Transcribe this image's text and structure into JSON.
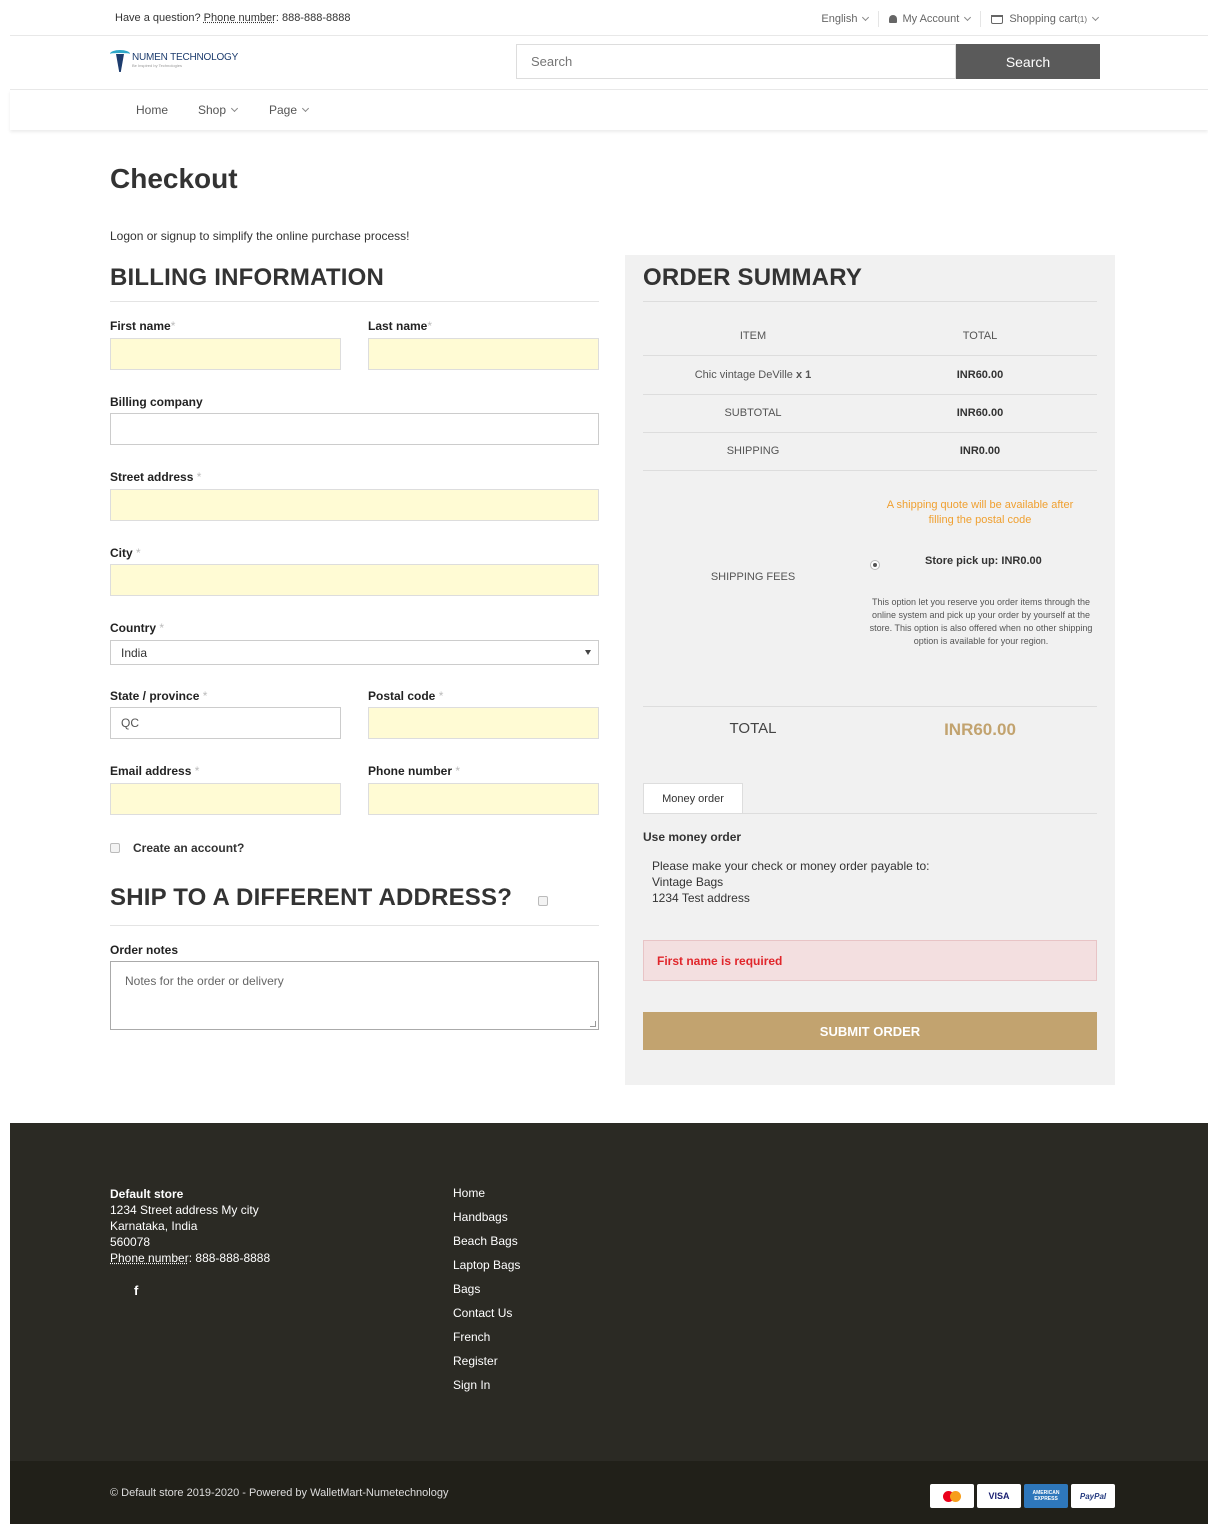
{
  "topbar": {
    "question_prefix": "Have a question? ",
    "phone_label": "Phone number",
    "phone_value": ": 888-888-8888",
    "language": "English",
    "account": "My Account",
    "cart": "Shopping cart",
    "cart_count": "(1)"
  },
  "header": {
    "logo_title": "NUMEN TECHNOLOGY",
    "logo_tagline": "Be Inspired by Technologies",
    "search_placeholder": "Search",
    "search_button": "Search"
  },
  "nav": {
    "home": "Home",
    "shop": "Shop",
    "page": "Page"
  },
  "page": {
    "title": "Checkout",
    "logon_message": "Logon or signup to simplify the online purchase process!"
  },
  "billing": {
    "title": "BILLING INFORMATION",
    "first_name": "First name",
    "last_name": "Last name",
    "company": "Billing company",
    "street": "Street address",
    "city": "City",
    "country": "Country",
    "country_value": "India",
    "state": "State / province",
    "state_value": "QC",
    "postal": "Postal code",
    "email": "Email address",
    "phone": "Phone number",
    "create_account": "Create an account?",
    "ship_title": "SHIP TO A DIFFERENT ADDRESS?",
    "order_notes": "Order notes",
    "order_notes_placeholder": "Notes for the order or delivery",
    "required_mark": "*"
  },
  "summary": {
    "title": "ORDER SUMMARY",
    "col_item": "ITEM",
    "col_total": "TOTAL",
    "item_name": "Chic vintage DeVille",
    "item_qty": " x 1",
    "item_total": "INR60.00",
    "subtotal_label": "SUBTOTAL",
    "subtotal_value": "INR60.00",
    "shipping_label": "SHIPPING",
    "shipping_value": "INR0.00",
    "shipping_fees_label": "SHIPPING FEES",
    "shipping_note": "A shipping quote will be available after filling the postal code",
    "pickup_label": "Store pick up: INR0.00",
    "pickup_desc": "This option let you reserve you order items through the online system and pick up your order by yourself at the store. This option is also offered when no other shipping option is available for your region.",
    "total_label": "TOTAL",
    "total_value": "INR60.00",
    "payment_tab": "Money order",
    "payment_title": "Use money order",
    "payment_line1": "Please make your check or money order payable to:",
    "payment_line2": "Vintage Bags",
    "payment_line3": "1234 Test address",
    "error": "First name is required",
    "submit": "SUBMIT ORDER"
  },
  "footer": {
    "store_name": "Default store",
    "address1": "1234 Street address My city",
    "address2": "Karnataka, India",
    "zip": "560078",
    "phone_label": "Phone number",
    "phone_value": ": 888-888-8888",
    "facebook": "f",
    "links": [
      "Home",
      "Handbags",
      "Beach Bags",
      "Laptop Bags",
      "Bags",
      "Contact Us",
      "French",
      "Register",
      "Sign In"
    ],
    "copyright": "© Default store 2019-2020 - Powered by WalletMart-Numetechnology",
    "payments": [
      "VISA",
      "AMERICAN EXPRESS",
      "PayPal"
    ]
  },
  "colors": {
    "accent": "#c2a36f",
    "footer_bg": "#2b2a24",
    "required_field": "#fffbd4",
    "error_text": "#e0262b",
    "shipping_note": "#f0a030"
  }
}
